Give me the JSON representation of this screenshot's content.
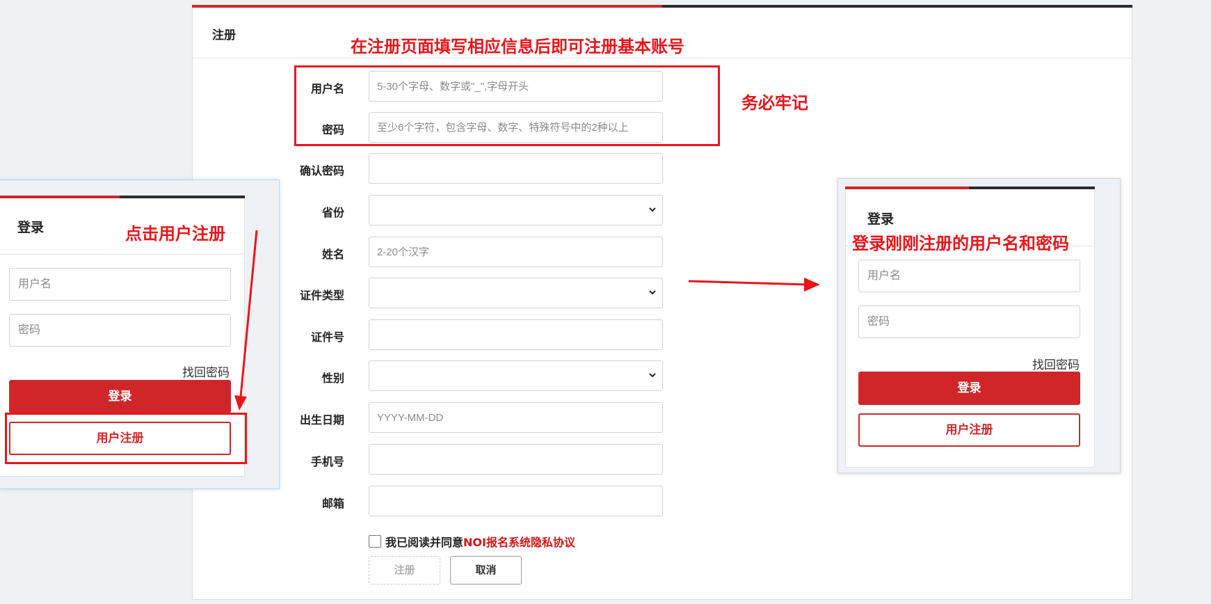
{
  "register": {
    "title": "注册",
    "fields": [
      {
        "label": "用户名",
        "placeholder": "5-30个字母、数字或\"_\",字母开头",
        "type": "text"
      },
      {
        "label": "密码",
        "placeholder": "至少6个字符，包含字母、数字、特殊符号中的2种以上",
        "type": "text"
      },
      {
        "label": "确认密码",
        "placeholder": "",
        "type": "text"
      },
      {
        "label": "省份",
        "placeholder": "",
        "type": "select"
      },
      {
        "label": "姓名",
        "placeholder": "2-20个汉字",
        "type": "text"
      },
      {
        "label": "证件类型",
        "placeholder": "",
        "type": "select"
      },
      {
        "label": "证件号",
        "placeholder": "",
        "type": "text"
      },
      {
        "label": "性别",
        "placeholder": "",
        "type": "select"
      },
      {
        "label": "出生日期",
        "placeholder": "YYYY-MM-DD",
        "type": "text"
      },
      {
        "label": "手机号",
        "placeholder": "",
        "type": "text"
      },
      {
        "label": "邮箱",
        "placeholder": "",
        "type": "text"
      }
    ],
    "agree_text": "我已阅读并同意",
    "agree_link": "NOI报名系统隐私协议",
    "register_button": "注册",
    "cancel_button": "取消"
  },
  "left_login": {
    "title": "登录",
    "username_placeholder": "用户名",
    "password_placeholder": "密码",
    "forgot": "找回密码",
    "login_button": "登录",
    "register_button": "用户注册"
  },
  "right_login": {
    "title": "登录",
    "username_placeholder": "用户名",
    "password_placeholder": "密码",
    "forgot": "找回密码",
    "login_button": "登录",
    "register_button": "用户注册"
  },
  "annotations": {
    "fill_info": "在注册页面填写相应信息后即可注册基本账号",
    "remember": "务必牢记",
    "click_register": "点击用户注册",
    "login_new": "登录刚刚注册的用户名和密码"
  },
  "colors": {
    "brand_red": "#d0262a",
    "annotation_red": "#e8151b",
    "dark_bar": "#2c2c2c"
  },
  "icons": {
    "select_chevron": "chevron-down-icon",
    "arrow": "arrow-icon"
  }
}
